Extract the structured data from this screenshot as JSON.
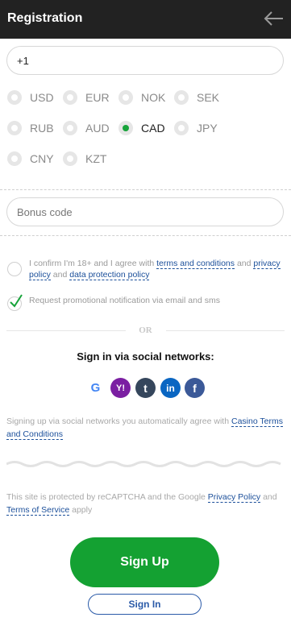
{
  "header": {
    "title": "Registration"
  },
  "phone": {
    "value": "+1"
  },
  "currencies": [
    "USD",
    "EUR",
    "NOK",
    "SEK",
    "RUB",
    "AUD",
    "CAD",
    "JPY",
    "CNY",
    "KZT"
  ],
  "selected_currency": "CAD",
  "bonus": {
    "placeholder": "Bonus code"
  },
  "consent": {
    "pre": "I confirm I'm 18+ and I agree with",
    "terms": "terms and conditions",
    "and1": "and",
    "privacy": "privacy policy",
    "and2": "and",
    "data_protection": "data protection policy"
  },
  "promo": {
    "text": "Request promotional notification via email and sms"
  },
  "or_text": "OR",
  "social": {
    "title": "Sign in via social networks:",
    "networks": [
      {
        "name": "google",
        "glyph": "G",
        "color": "#ffffff"
      },
      {
        "name": "yahoo",
        "glyph": "Y!",
        "color": "#7b1fa2"
      },
      {
        "name": "tumblr",
        "glyph": "t",
        "color": "#35465c"
      },
      {
        "name": "linkedin",
        "glyph": "in",
        "color": "#0a66c2"
      },
      {
        "name": "facebook",
        "glyph": "f",
        "color": "#3b5998"
      }
    ]
  },
  "social_note": {
    "text": "Signing up via social networks you automatically agree with",
    "link": "Casino Terms and Conditions"
  },
  "recaptcha": {
    "text1": "This site is protected by reCAPTCHA and the Google",
    "privacy": "Privacy Policy",
    "and": "and",
    "terms": "Terms of Service",
    "apply": "apply"
  },
  "buttons": {
    "signup": "Sign Up",
    "signin": "Sign In"
  }
}
